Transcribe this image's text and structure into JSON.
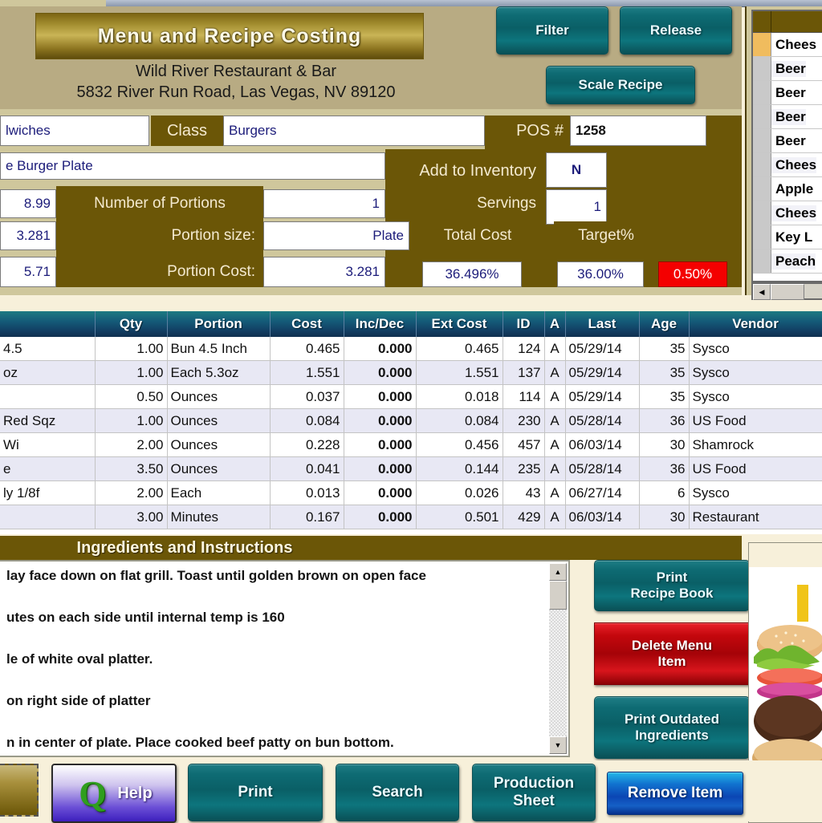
{
  "app": {
    "title": "Menu  and  Recipe  Costing",
    "restaurant_name": "Wild River Restaurant & Bar",
    "restaurant_address": "5832 River Run Road, Las Vegas, NV 89120"
  },
  "header_buttons": {
    "filter": "Filter",
    "release": "Release",
    "scale_recipe": "Scale Recipe"
  },
  "form": {
    "menu_group_value": "lwiches",
    "class_label": "Class",
    "class_value": "Burgers",
    "pos_label": "POS #",
    "pos_value": "1258",
    "item_name_value": "e Burger Plate",
    "add_to_inventory_label": "Add to Inventory",
    "add_to_inventory_value": "N",
    "price_value": "8.99",
    "portions_label": "Number of Portions",
    "portions_value": "1",
    "servings_label": "Servings",
    "servings_value": "1",
    "cost_value": "3.281",
    "portion_size_label": "Portion size:",
    "portion_size_value": "Plate",
    "total_cost_label": "Total Cost",
    "target_pct_label": "Target%",
    "margin_value": "5.71",
    "portion_cost_label": "Portion Cost:",
    "portion_cost_value": "3.281",
    "food_cost_pct_value": "36.496%",
    "target_value": "36.00%",
    "variance_value": "0.50%",
    "variance_color": "#f40000"
  },
  "sidebar": {
    "items": [
      {
        "label": "Chees",
        "selected": true
      },
      {
        "label": "Beer ",
        "selected": false
      },
      {
        "label": "Beer ",
        "selected": false
      },
      {
        "label": "Beer ",
        "selected": false
      },
      {
        "label": "Beer ",
        "selected": false
      },
      {
        "label": "Chees",
        "selected": false
      },
      {
        "label": "Apple",
        "selected": false
      },
      {
        "label": "Chees",
        "selected": false
      },
      {
        "label": "Key L",
        "selected": false
      },
      {
        "label": "Peach",
        "selected": false
      }
    ],
    "scroll_left_icon": "left-arrow"
  },
  "ingredients_grid": {
    "columns": [
      "",
      "Qty",
      "Portion",
      "Cost",
      "Inc/Dec",
      "Ext Cost",
      "ID",
      "A",
      "Last",
      "Age",
      "Vendor"
    ],
    "rows": [
      {
        "name": "4.5",
        "qty": "1.00",
        "portion": "Bun 4.5 Inch",
        "cost": "0.465",
        "incdec": "0.000",
        "ext": "0.465",
        "id": "124",
        "a": "A",
        "last": "05/29/14",
        "age": "35",
        "vendor": "Sysco"
      },
      {
        "name": "oz",
        "qty": "1.00",
        "portion": "Each 5.3oz",
        "cost": "1.551",
        "incdec": "0.000",
        "ext": "1.551",
        "id": "137",
        "a": "A",
        "last": "05/29/14",
        "age": "35",
        "vendor": "Sysco"
      },
      {
        "name": "",
        "qty": "0.50",
        "portion": "Ounces",
        "cost": "0.037",
        "incdec": "0.000",
        "ext": "0.018",
        "id": "114",
        "a": "A",
        "last": "05/29/14",
        "age": "35",
        "vendor": "Sysco"
      },
      {
        "name": " Red Sqz",
        "qty": "1.00",
        "portion": "Ounces",
        "cost": "0.084",
        "incdec": "0.000",
        "ext": "0.084",
        "id": "230",
        "a": "A",
        "last": "05/28/14",
        "age": "36",
        "vendor": "US Food"
      },
      {
        "name": "Wi",
        "qty": "2.00",
        "portion": "Ounces",
        "cost": "0.228",
        "incdec": "0.000",
        "ext": "0.456",
        "id": "457",
        "a": "A",
        "last": "06/03/14",
        "age": "30",
        "vendor": "Shamrock"
      },
      {
        "name": "e",
        "qty": "3.50",
        "portion": "Ounces",
        "cost": "0.041",
        "incdec": "0.000",
        "ext": "0.144",
        "id": "235",
        "a": "A",
        "last": "05/28/14",
        "age": "36",
        "vendor": "US Food"
      },
      {
        "name": "ly 1/8f",
        "qty": "2.00",
        "portion": "Each",
        "cost": "0.013",
        "incdec": "0.000",
        "ext": "0.026",
        "id": "43",
        "a": "A",
        "last": "06/27/14",
        "age": "6",
        "vendor": "Sysco"
      },
      {
        "name": "",
        "qty": "3.00",
        "portion": "Minutes",
        "cost": "0.167",
        "incdec": "0.000",
        "ext": "0.501",
        "id": "429",
        "a": "A",
        "last": "06/03/14",
        "age": "30",
        "vendor": "Restaurant"
      }
    ]
  },
  "instructions": {
    "header": "Ingredients and Instructions",
    "lines": [
      "lay face down on flat grill. Toast until golden brown on open face",
      "",
      "utes on each side until internal temp is 160",
      "",
      "le of white oval platter.",
      "",
      "on right side of platter",
      "",
      "n in center of plate. Place cooked beef patty on bun bottom."
    ]
  },
  "side_buttons": {
    "print_recipe_book": "Print\nRecipe Book",
    "print_recipe_book_l1": "Print",
    "print_recipe_book_l2": "Recipe Book",
    "delete_menu_item_l1": "Delete  Menu",
    "delete_menu_item_l2": "Item",
    "print_outdated_l1": "Print Outdated",
    "print_outdated_l2": "Ingredients"
  },
  "toolbar": {
    "help": "Help",
    "print": "Print",
    "search": "Search",
    "production_l1": "Production",
    "production_l2": "Sheet",
    "remove_item": "Remove Item"
  },
  "colors": {
    "olive": "#6b5607",
    "teal": "#0e6b73",
    "red": "#c4070d",
    "blue": "#0b46b4",
    "cream": "#f7f0da",
    "tan": "#cfc79c"
  }
}
